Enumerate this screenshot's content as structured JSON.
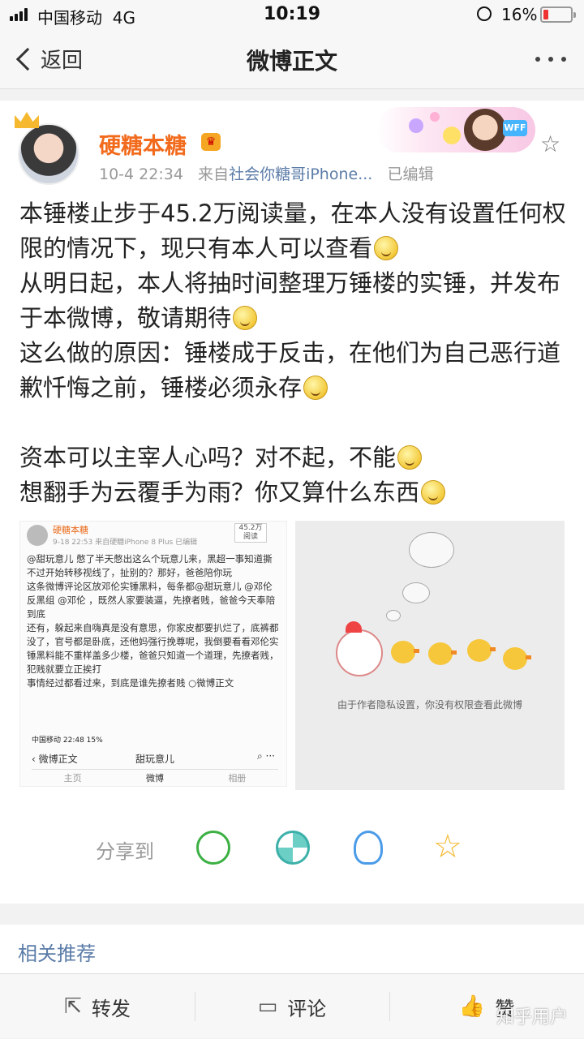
{
  "status_bar": {
    "carrier": "中国移动",
    "network": "4G",
    "time": "10:19",
    "battery": "16%"
  },
  "nav": {
    "back_label": "返回",
    "title": "微博正文"
  },
  "post": {
    "author": "硬糖本糖",
    "time": "10-4 22:34",
    "source_prefix": "来自",
    "source": "社会你糖哥iPhone...",
    "edited": "已编辑",
    "banner_tag": "WFF",
    "paragraphs": [
      "本锤楼止步于45.2万阅读量，在本人没有设置任何权限的情况下，现只有本人可以查看",
      "从明日起，本人将抽时间整理万锤楼的实锤，并发布于本微博，敬请期待",
      "这么做的原因：锤楼成于反击，在他们为自己恶行道歉忏悔之前，锤楼必须永存",
      "",
      "资本可以主宰人心吗？对不起，不能",
      "想翻手为云覆手为雨？你又算什么东西"
    ]
  },
  "image1": {
    "name": "硬糖本糖",
    "meta": "9-18 22:53  来自硬糖iPhone 8 Plus  已编辑",
    "badge": "45.2万\n阅读",
    "body_lines": [
      "@甜玩意儿 憋了半天憋出这么个玩意儿来，黑超一事知道撕不过开始转移视线了，扯别的？那好，爸爸陪你玩",
      "这条微博评论区放邓伦实锤黑料，每条都@甜玩意儿 @邓伦反黑组 @邓伦 ，既然人家要装逼，先撩者贱，爸爸今天奉陪到底",
      "还有，躲起来自嗨真是没有意思，你家皮都要扒烂了，底裤都没了，官号都是卧底，还他妈强行挽尊呢，我倒要看看邓伦实锤黑料能不重样盖多少楼，爸爸只知道一个道理，先撩者贱，犯贱就要立正挨打",
      "事情经过都看过来，到底是谁先撩者贱 ○微博正文"
    ],
    "status": "中国移动   22:48   15%",
    "nav_back": "微博正文",
    "nav_title": "甜玩意儿",
    "tabs": [
      "主页",
      "微博",
      "相册"
    ]
  },
  "image2": {
    "message": "由于作者隐私设置，你没有权限查看此微博"
  },
  "share": {
    "label": "分享到"
  },
  "related": {
    "label": "相关推荐"
  },
  "bottom": {
    "repost": "转发",
    "comment": "评论",
    "like": "赞"
  },
  "watermark": "知乎用户"
}
